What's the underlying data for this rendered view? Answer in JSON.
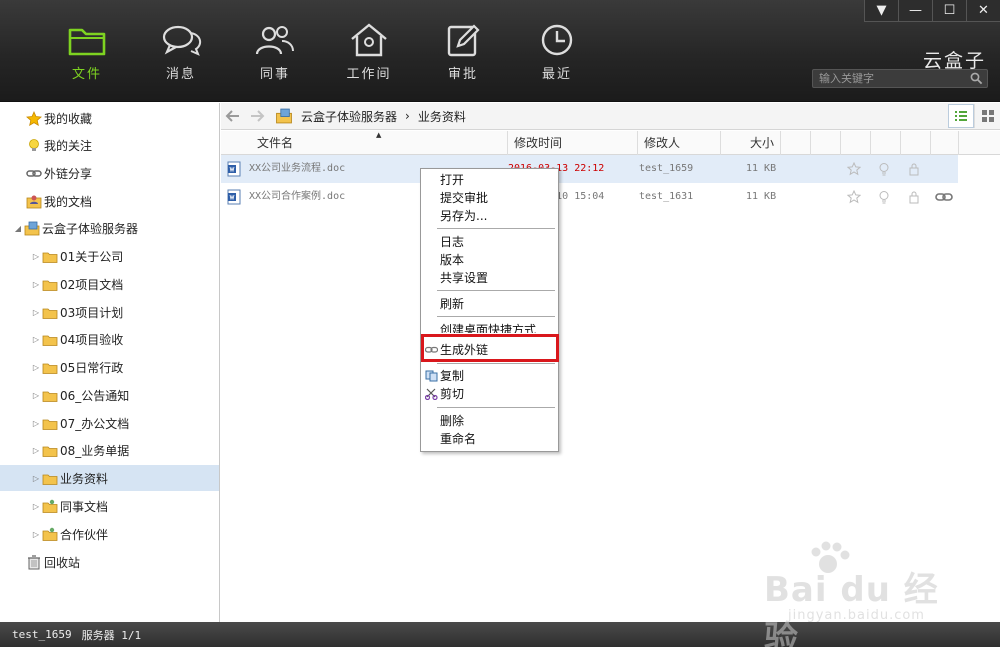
{
  "window": {
    "controls": [
      "▼",
      "—",
      "☐",
      "✕"
    ]
  },
  "nav": {
    "items": [
      {
        "label": "文件",
        "icon": "folder-icon",
        "active": true
      },
      {
        "label": "消息",
        "icon": "chat-icon"
      },
      {
        "label": "同事",
        "icon": "people-icon"
      },
      {
        "label": "工作间",
        "icon": "house-icon"
      },
      {
        "label": "审批",
        "icon": "edit-icon"
      },
      {
        "label": "最近",
        "icon": "clock-icon"
      }
    ],
    "active_color": "#7ed321"
  },
  "brand": "云盒子",
  "search": {
    "placeholder": "输入关键字"
  },
  "sidebar": {
    "items": [
      {
        "label": "我的收藏",
        "icon": "star-icon"
      },
      {
        "label": "我的关注",
        "icon": "bulb-icon"
      },
      {
        "label": "外链分享",
        "icon": "link-icon"
      },
      {
        "label": "我的文档",
        "icon": "user-folder-icon"
      },
      {
        "label": "云盒子体验服务器",
        "icon": "server-icon"
      },
      {
        "label": "01关于公司",
        "icon": "folder-icon"
      },
      {
        "label": "02项目文档",
        "icon": "folder-icon"
      },
      {
        "label": "03项目计划",
        "icon": "folder-icon"
      },
      {
        "label": "04项目验收",
        "icon": "folder-icon"
      },
      {
        "label": "05日常行政",
        "icon": "folder-icon"
      },
      {
        "label": "06_公告通知",
        "icon": "folder-icon"
      },
      {
        "label": "07_办公文档",
        "icon": "folder-icon"
      },
      {
        "label": "08_业务单据",
        "icon": "folder-icon"
      },
      {
        "label": "业务资料",
        "icon": "folder-icon",
        "selected": true
      },
      {
        "label": "同事文档",
        "icon": "shared-folder-icon"
      },
      {
        "label": "合作伙伴",
        "icon": "shared-folder-icon"
      },
      {
        "label": "回收站",
        "icon": "trash-icon"
      }
    ]
  },
  "breadcrumb": {
    "items": [
      "云盒子体验服务器",
      "业务资料"
    ],
    "separator": "›"
  },
  "table": {
    "columns": [
      "文件名",
      "修改时间",
      "修改人",
      "大小"
    ],
    "rows": [
      {
        "name": "XX公司业务流程.doc",
        "modified": "2016-03-13 22:12",
        "user": "test_1659",
        "size": "11 KB"
      },
      {
        "name": "XX公司合作案例.doc",
        "modified": "2016-03-10 15:04",
        "user": "test_1631",
        "size": "11 KB"
      }
    ]
  },
  "context_menu": {
    "items": [
      "打开",
      "提交审批",
      "另存为...",
      "日志",
      "版本",
      "共享设置",
      "刷新",
      "创建桌面快捷方式",
      "生成外链",
      "复制",
      "剪切",
      "删除",
      "重命名"
    ]
  },
  "status": {
    "user": "test_1659",
    "server": "服务器 1/1"
  },
  "watermark": {
    "big": "Bai du 经验",
    "small": "jingyan.baidu.com"
  }
}
